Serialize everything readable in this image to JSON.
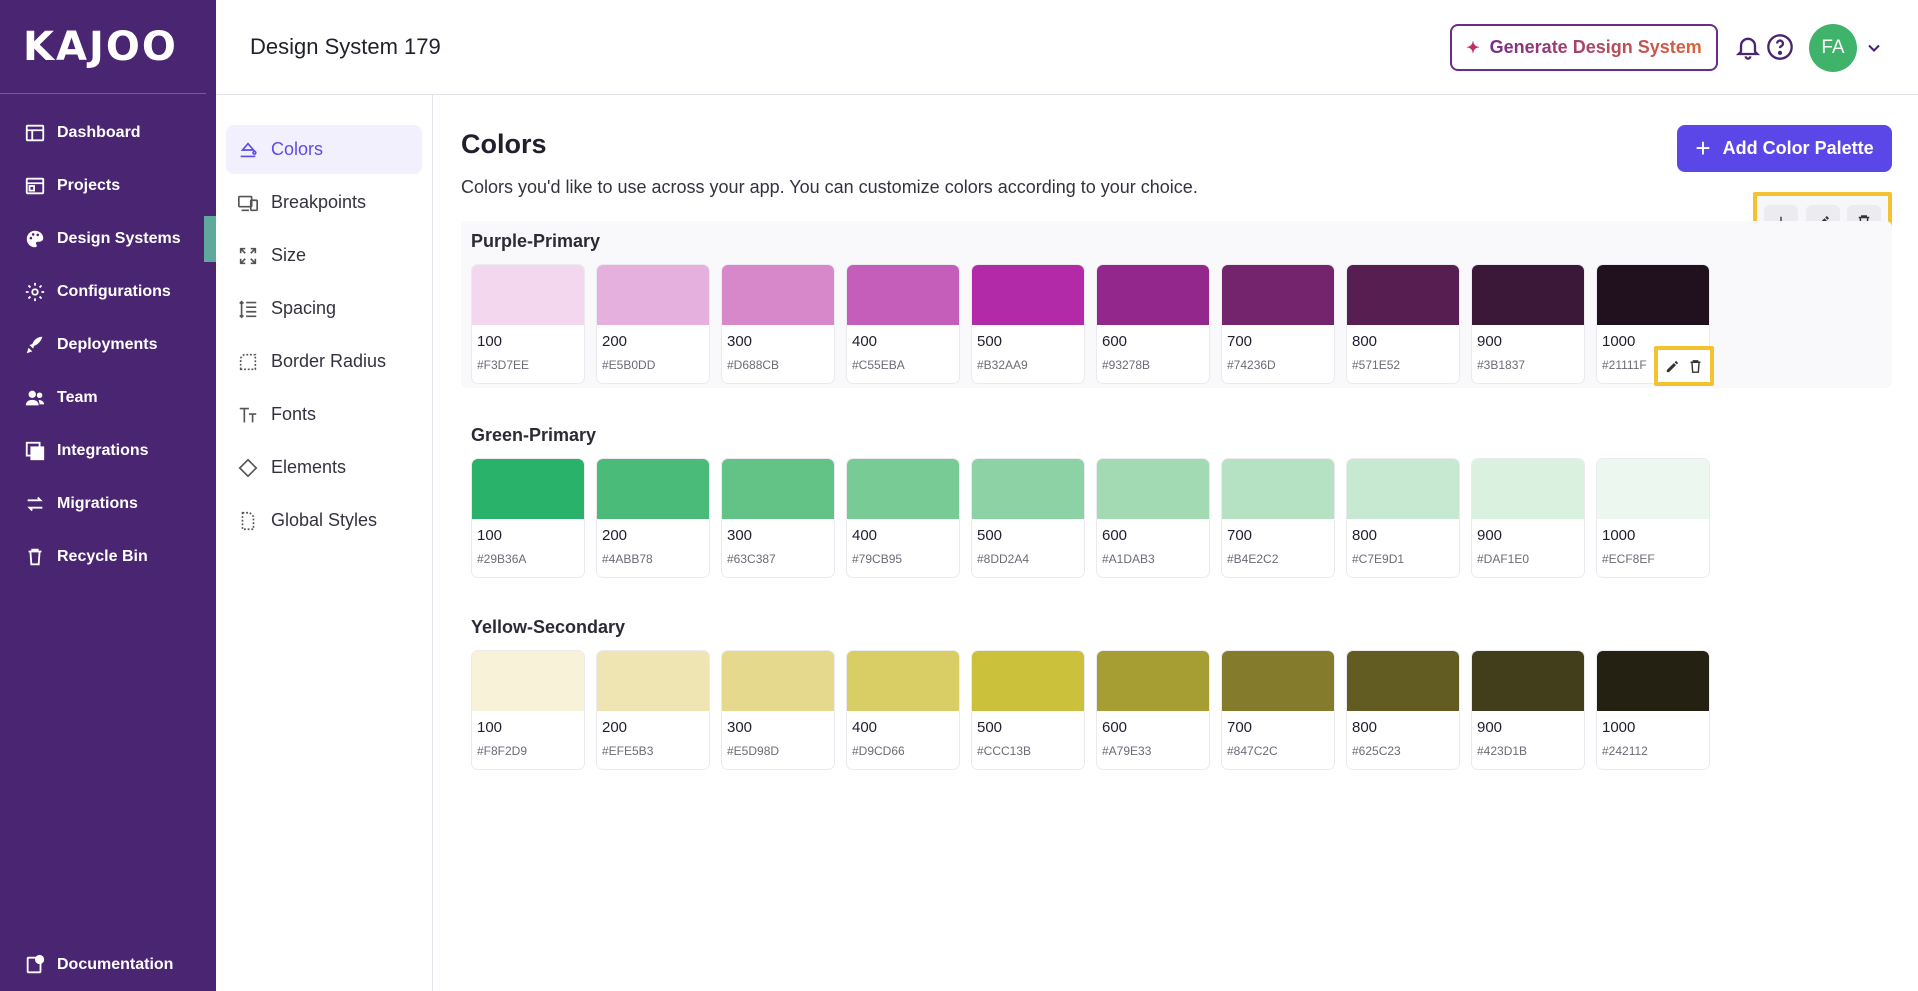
{
  "brand": {
    "logo_text": "KAJOO"
  },
  "nav": {
    "items": [
      {
        "label": "Dashboard",
        "icon": "dashboard-icon"
      },
      {
        "label": "Projects",
        "icon": "projects-icon"
      },
      {
        "label": "Design Systems",
        "icon": "palette-icon",
        "active": true
      },
      {
        "label": "Configurations",
        "icon": "gear-icon"
      },
      {
        "label": "Deployments",
        "icon": "rocket-icon"
      },
      {
        "label": "Team",
        "icon": "team-icon"
      },
      {
        "label": "Integrations",
        "icon": "integrations-icon"
      },
      {
        "label": "Migrations",
        "icon": "migrations-icon"
      },
      {
        "label": "Recycle Bin",
        "icon": "trash-icon"
      }
    ],
    "bottom": {
      "label": "Documentation",
      "icon": "documentation-icon"
    }
  },
  "header": {
    "title": "Design System 179",
    "generate_label": "Generate Design System",
    "avatar_initials": "FA"
  },
  "subnav": {
    "items": [
      {
        "label": "Colors",
        "icon": "colors-icon",
        "active": true
      },
      {
        "label": "Breakpoints",
        "icon": "breakpoints-icon"
      },
      {
        "label": "Size",
        "icon": "size-icon"
      },
      {
        "label": "Spacing",
        "icon": "spacing-icon"
      },
      {
        "label": "Border Radius",
        "icon": "border-radius-icon"
      },
      {
        "label": "Fonts",
        "icon": "fonts-icon"
      },
      {
        "label": "Elements",
        "icon": "elements-icon"
      },
      {
        "label": "Global Styles",
        "icon": "global-styles-icon"
      }
    ]
  },
  "main": {
    "title": "Colors",
    "subtitle": "Colors you'd like to use across your app. You can customize colors according to your choice.",
    "add_label": "Add Color Palette"
  },
  "palettes": [
    {
      "name": "Purple-Primary",
      "swatches": [
        {
          "shade": "100",
          "hex": "#F3D7EE"
        },
        {
          "shade": "200",
          "hex": "#E5B0DD"
        },
        {
          "shade": "300",
          "hex": "#D688CB"
        },
        {
          "shade": "400",
          "hex": "#C55EBA"
        },
        {
          "shade": "500",
          "hex": "#B32AA9"
        },
        {
          "shade": "600",
          "hex": "#93278B"
        },
        {
          "shade": "700",
          "hex": "#74236D"
        },
        {
          "shade": "800",
          "hex": "#571E52"
        },
        {
          "shade": "900",
          "hex": "#3B1837"
        },
        {
          "shade": "1000",
          "hex": "#21111F"
        }
      ]
    },
    {
      "name": "Green-Primary",
      "swatches": [
        {
          "shade": "100",
          "hex": "#29B36A"
        },
        {
          "shade": "200",
          "hex": "#4ABB78"
        },
        {
          "shade": "300",
          "hex": "#63C387"
        },
        {
          "shade": "400",
          "hex": "#79CB95"
        },
        {
          "shade": "500",
          "hex": "#8DD2A4"
        },
        {
          "shade": "600",
          "hex": "#A1DAB3"
        },
        {
          "shade": "700",
          "hex": "#B4E2C2"
        },
        {
          "shade": "800",
          "hex": "#C7E9D1"
        },
        {
          "shade": "900",
          "hex": "#DAF1E0"
        },
        {
          "shade": "1000",
          "hex": "#ECF8EF"
        }
      ]
    },
    {
      "name": "Yellow-Secondary",
      "swatches": [
        {
          "shade": "100",
          "hex": "#F8F2D9"
        },
        {
          "shade": "200",
          "hex": "#EFE5B3"
        },
        {
          "shade": "300",
          "hex": "#E5D98D"
        },
        {
          "shade": "400",
          "hex": "#D9CD66"
        },
        {
          "shade": "500",
          "hex": "#CCC13B"
        },
        {
          "shade": "600",
          "hex": "#A79E33"
        },
        {
          "shade": "700",
          "hex": "#847C2C"
        },
        {
          "shade": "800",
          "hex": "#625C23"
        },
        {
          "shade": "900",
          "hex": "#423D1B"
        },
        {
          "shade": "1000",
          "hex": "#242112"
        }
      ]
    }
  ],
  "colors": {
    "sidebar_bg": "#4A2571",
    "accent": "#5B46E8",
    "highlight": "#F2C230"
  }
}
